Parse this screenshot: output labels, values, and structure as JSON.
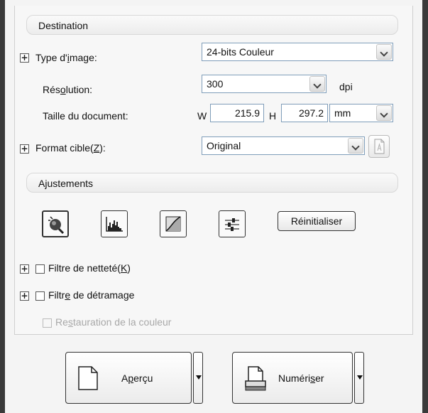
{
  "destination": {
    "section_title": "Destination",
    "image_type_label_a": "Type d'",
    "image_type_label_u": "i",
    "image_type_label_b": "mage:",
    "image_type_value": "24-bits Couleur",
    "resolution_label_a": "Rés",
    "resolution_label_u": "o",
    "resolution_label_b": "lution:",
    "resolution_value": "300",
    "resolution_unit": "dpi",
    "doc_size_label": "Taille du document:",
    "width_label": "W",
    "width_value": "215.9",
    "height_label": "H",
    "height_value": "297.2",
    "size_unit": "mm",
    "target_format_label_a": "Format cible(",
    "target_format_label_u": "Z",
    "target_format_label_b": "):",
    "target_format_value": "Original"
  },
  "adjustments": {
    "section_title": "Ajustements",
    "tools": [
      "auto-exposure-icon",
      "histogram-icon",
      "tone-curve-icon",
      "image-adjust-icon"
    ],
    "reset_label": "Réinitialiser",
    "sharpen_label_a": "Filtre de netteté(",
    "sharpen_label_u": "K",
    "sharpen_label_b": ")",
    "descreen_label_a": "Filtr",
    "descreen_label_u": "e",
    "descreen_label_b": " de détramage",
    "color_restore_label_a": "Re",
    "color_restore_label_u": "s",
    "color_restore_label_b": "tauration de la couleur"
  },
  "actions": {
    "preview_a": "A",
    "preview_u": "p",
    "preview_b": "erçu",
    "scan_a": "Numéri",
    "scan_u": "s",
    "scan_b": "er"
  }
}
